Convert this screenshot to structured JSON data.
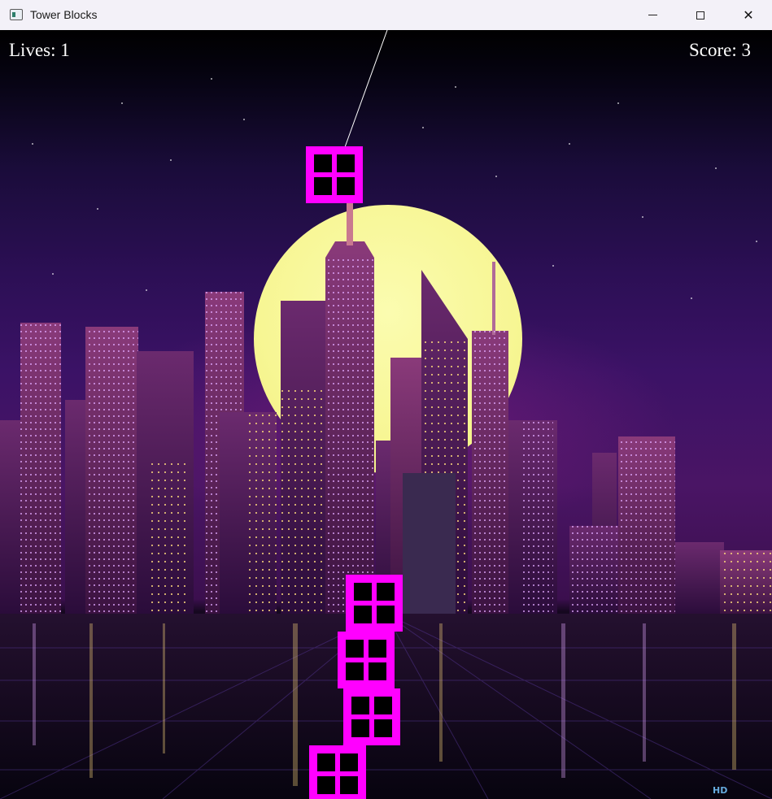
{
  "window": {
    "title": "Tower Blocks",
    "controls": {
      "minimize": "minimize",
      "maximize": "maximize",
      "close": "✕"
    }
  },
  "hud": {
    "lives_text": "Lives: 1",
    "score_text": "Score: 3"
  },
  "game": {
    "block_color": "#ff00ff",
    "window_color": "#000000",
    "moon_color": "#f7f694",
    "stacked_blocks": 4,
    "falling_block": "swinging on rope",
    "watermark": "HD"
  }
}
